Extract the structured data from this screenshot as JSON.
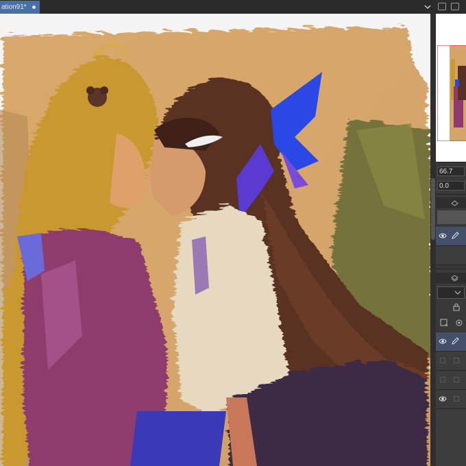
{
  "tab": {
    "title": "ation91*"
  },
  "navigator": {
    "zoom_value": "66.7",
    "rotation_value": "0.0"
  },
  "icons": {
    "tab_close": "dot-icon",
    "tab_menu": "chevron-down-icon",
    "layer_visible": "eye-icon",
    "layer_edit": "pen-icon",
    "panel_layers": "layers-icon"
  },
  "colors": {
    "tab_active": "#4a6fa5",
    "panel_bg": "#393939",
    "selected_layer": "#44506a"
  }
}
